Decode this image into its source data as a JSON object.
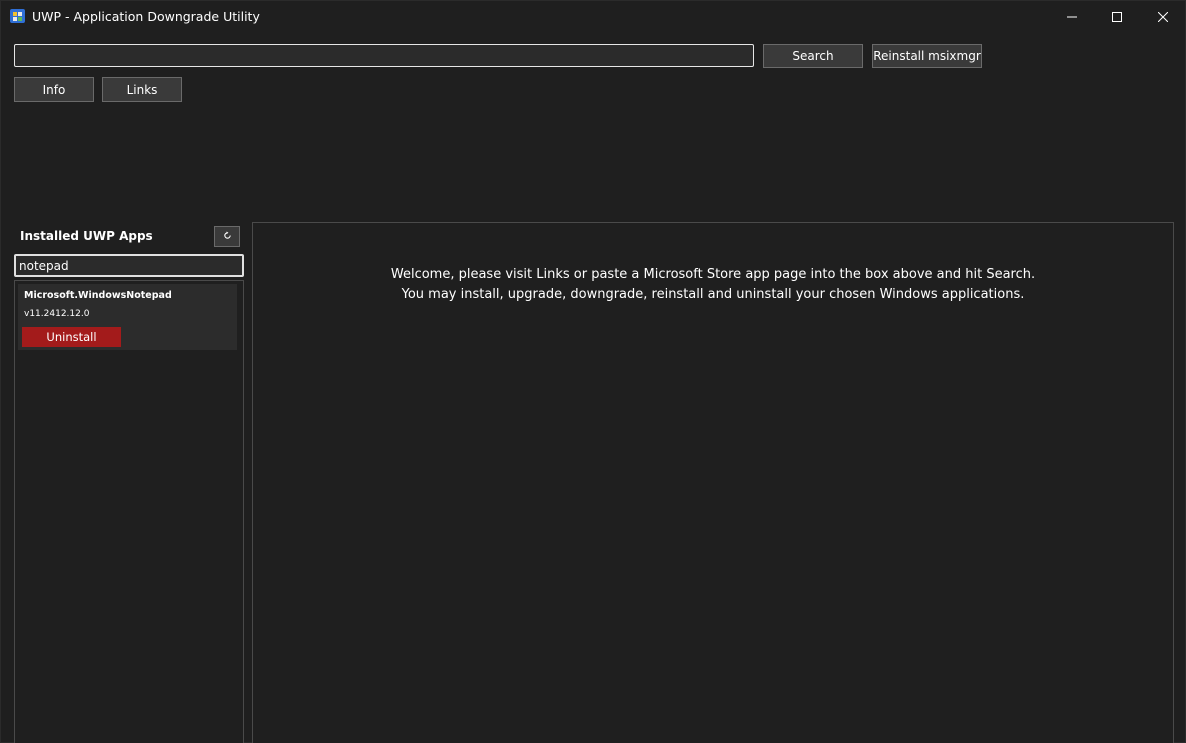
{
  "window": {
    "title": "UWP - Application Downgrade Utility",
    "controls": [
      "minimize-icon",
      "maximize-icon",
      "close-icon"
    ]
  },
  "toolbar": {
    "url_value": "",
    "search_label": "Search",
    "reinstall_label": "Reinstall msixmgr",
    "info_label": "Info",
    "links_label": "Links"
  },
  "installed": {
    "title": "Installed UWP Apps",
    "refresh_icon": "refresh-icon",
    "filter_value": "notepad",
    "apps": [
      {
        "name": "Microsoft.WindowsNotepad",
        "version": "v11.2412.12.0",
        "action_label": "Uninstall"
      }
    ]
  },
  "content": {
    "welcome_line1": "Welcome, please visit Links or paste a Microsoft Store app page into the box above and hit Search.",
    "welcome_line2": "You may install, upgrade, downgrade, reinstall and uninstall your chosen Windows applications."
  },
  "colors": {
    "background": "#1f1f1f",
    "uninstall": "#a31b1b",
    "border": "#4a4a4a"
  }
}
